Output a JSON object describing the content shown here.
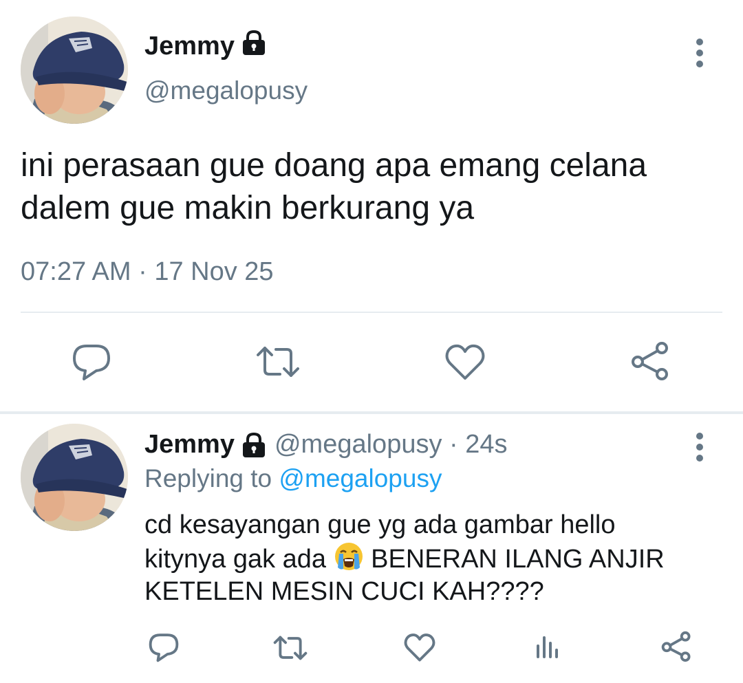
{
  "main_tweet": {
    "author_name": "Jemmy",
    "handle": "@megalopusy",
    "text_line1": "ini perasaan gue doang apa emang celana",
    "text_line2": "dalem gue makin berkurang ya",
    "timestamp": "07:27 AM · 17 Nov 25",
    "icons": [
      "lock-icon",
      "more-vertical-icon",
      "reply-icon",
      "retweet-icon",
      "like-icon",
      "share-icon"
    ]
  },
  "reply_tweet": {
    "author_name": "Jemmy",
    "meta": "@megalopusy · 24s",
    "replying_prefix": "Replying to ",
    "replying_handle": "@megalopusy",
    "text_line1": "cd kesayangan gue yg ada gambar hello",
    "text_line2_before": "kitynya gak ada ",
    "text_line2_after": " BENERAN ILANG ANJIR",
    "text_line3": "KETELEN MESIN CUCI KAH????",
    "emoji": "loudly-crying-face",
    "icons": [
      "lock-icon",
      "more-vertical-icon",
      "reply-icon",
      "retweet-icon",
      "like-icon",
      "stats-icon",
      "share-icon"
    ]
  },
  "colors": {
    "text": "#14171a",
    "secondary": "#657786",
    "link": "#1da1f2",
    "divider": "#e6ecf0"
  }
}
